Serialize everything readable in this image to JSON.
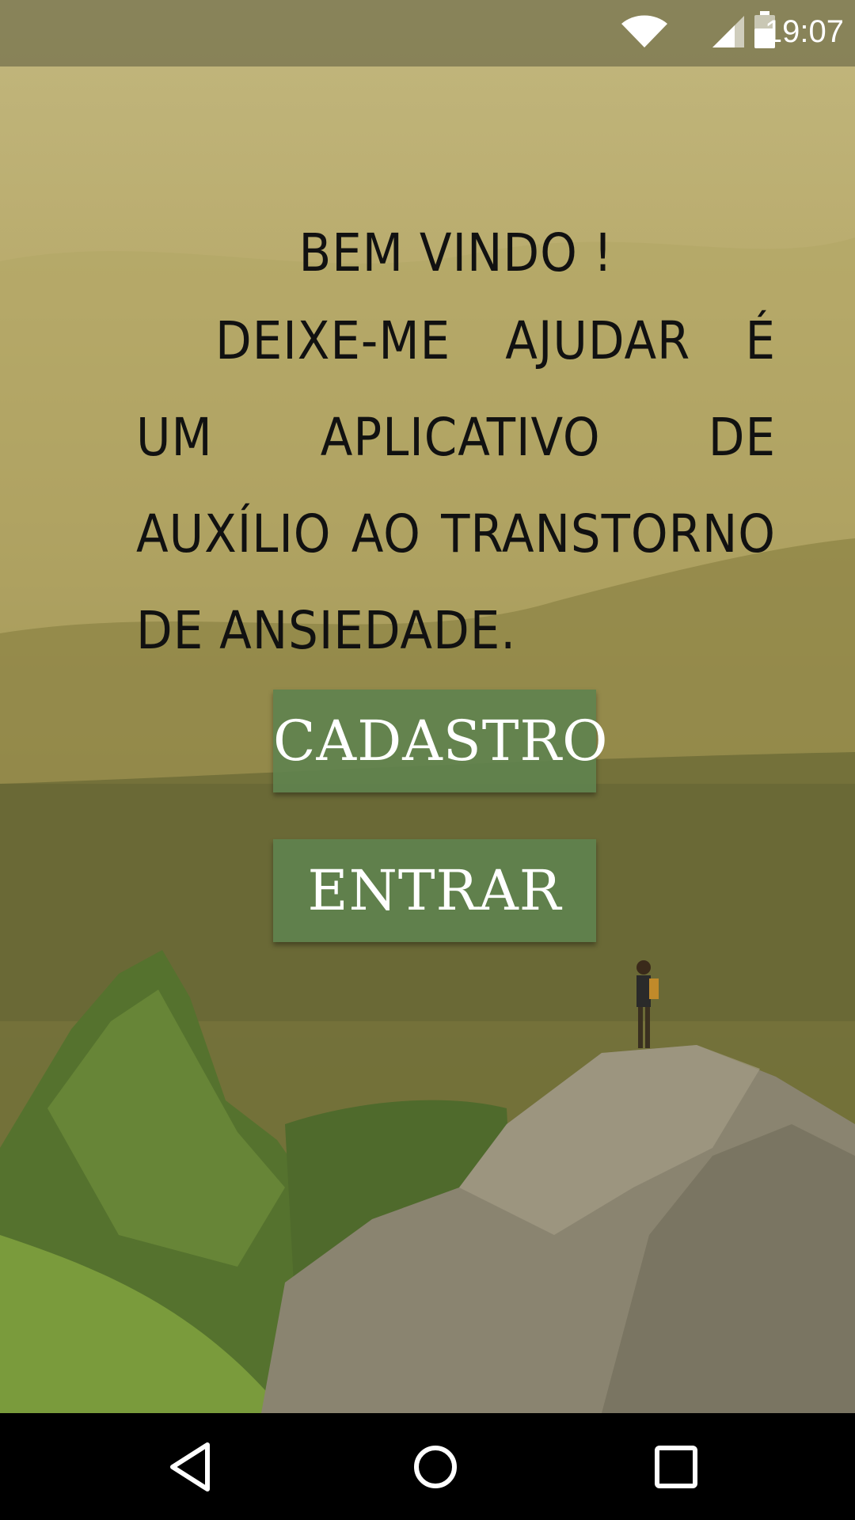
{
  "status_bar": {
    "time": "19:07",
    "icons": [
      "wifi-icon",
      "cell-signal-icon",
      "battery-icon"
    ]
  },
  "welcome": {
    "title": "Bem vindo !",
    "body": "deixe-me ajudar é um aplicativo de auxílio ao transtorno de ansiedade."
  },
  "buttons": {
    "cadastro": "Cadastro",
    "entrar": "Entrar"
  },
  "nav_bar": {
    "icons": [
      "back-icon",
      "home-icon",
      "recents-icon"
    ]
  },
  "colors": {
    "button_bg": "#60824e",
    "text": "#111111"
  }
}
